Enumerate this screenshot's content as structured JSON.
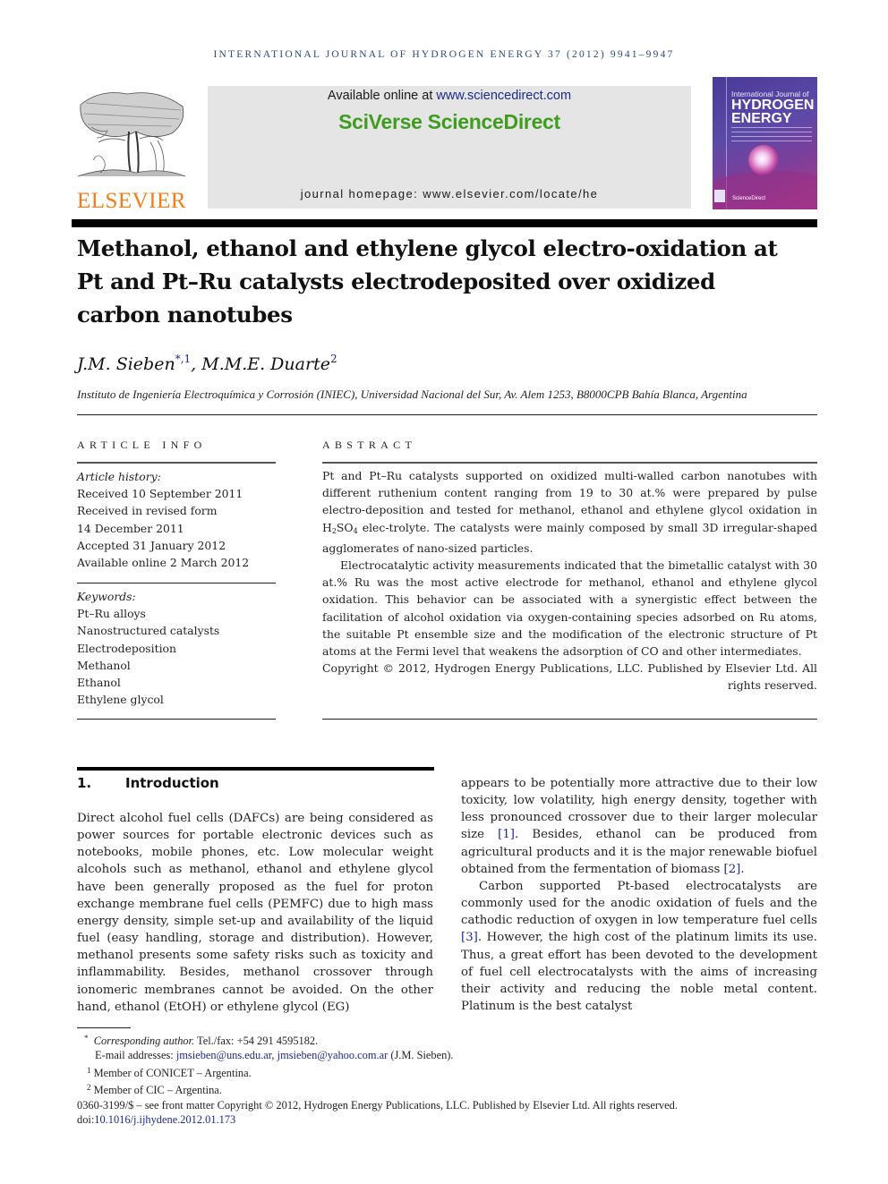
{
  "header": {
    "journal_citation": "INTERNATIONAL JOURNAL OF HYDROGEN ENERGY 37 (2012) 9941–9947",
    "publisher_wordmark": "ELSEVIER",
    "available_online_prefix": "Available online at ",
    "available_online_link": "www.sciencedirect.com",
    "platform_name": "SciVerse ScienceDirect",
    "journal_homepage": "journal homepage: www.elsevier.com/locate/he",
    "cover": {
      "line1": "International Journal of",
      "line2": "HYDROGEN",
      "line3": "ENERGY",
      "footer": "ScienceDirect"
    }
  },
  "article": {
    "title": "Methanol, ethanol and ethylene glycol electro-oxidation at Pt and Pt–Ru catalysts electrodeposited over oxidized carbon nanotubes",
    "authors": [
      {
        "name": "J.M. Sieben",
        "marks": "*,1"
      },
      {
        "name": "M.M.E. Duarte",
        "marks": "2"
      }
    ],
    "author_separator": ", ",
    "affiliation": "Instituto de Ingeniería Electroquímica y Corrosión (INIEC), Universidad Nacional del Sur, Av. Alem 1253, B8000CPB Bahía Blanca, Argentina"
  },
  "article_info": {
    "heading": "ARTICLE INFO",
    "history_label": "Article history:",
    "history": [
      "Received 10 September 2011",
      "Received in revised form",
      "14 December 2011",
      "Accepted 31 January 2012",
      "Available online 2 March 2012"
    ],
    "keywords_label": "Keywords:",
    "keywords": [
      "Pt–Ru alloys",
      "Nanostructured catalysts",
      "Electrodeposition",
      "Methanol",
      "Ethanol",
      "Ethylene glycol"
    ]
  },
  "abstract": {
    "heading": "ABSTRACT",
    "p1_before": "Pt and Pt–Ru catalysts supported on oxidized multi-walled carbon nanotubes with different ruthenium content ranging from 19 to 30 at.% were prepared by pulse electro-deposition and tested for methanol, ethanol and ethylene glycol oxidation in H",
    "p1_sub1": "2",
    "p1_mid": "SO",
    "p1_sub2": "4",
    "p1_after": " elec-trolyte. The catalysts were mainly composed by small 3D irregular-shaped agglomerates of nano-sized particles.",
    "p2": "Electrocatalytic activity measurements indicated that the bimetallic catalyst with 30 at.% Ru was the most active electrode for methanol, ethanol and ethylene glycol oxidation. This behavior can be associated with a synergistic effect between the facilitation of alcohol oxidation via oxygen-containing species adsorbed on Ru atoms, the suitable Pt ensemble size and the modification of the electronic structure of Pt atoms at the Fermi level that weakens the adsorption of CO and other intermediates.",
    "copyright": "Copyright © 2012, Hydrogen Energy Publications, LLC. Published by Elsevier Ltd. All rights reserved."
  },
  "introduction": {
    "number": "1.",
    "heading": "Introduction",
    "left_col_p1": "Direct alcohol fuel cells (DAFCs) are being considered as power sources for portable electronic devices such as notebooks, mobile phones, etc. Low molecular weight alcohols such as methanol, ethanol and ethylene glycol have been generally proposed as the fuel for proton exchange membrane fuel cells (PEMFC) due to high mass energy density, simple set-up and availability of the liquid fuel (easy handling, storage and distribution). However, methanol presents some safety risks such as toxicity and inflammability. Besides, methanol crossover through ionomeric membranes cannot be avoided. On the other hand, ethanol (EtOH) or ethylene glycol (EG)",
    "right_col_p1a": "appears to be potentially more attractive due to their low toxicity, low volatility, high energy density, together with less pronounced crossover due to their larger molecular size ",
    "ref1": "[1]",
    "right_col_p1b": ". Besides, ethanol can be produced from agricultural products and it is the major renewable biofuel obtained from the fermentation of biomass ",
    "ref2": "[2]",
    "right_col_p1c": ".",
    "right_col_p2a": "Carbon supported Pt-based electrocatalysts are commonly used for the anodic oxidation of fuels and the cathodic reduction of oxygen in low temperature fuel cells ",
    "ref3": "[3]",
    "right_col_p2b": ". However, the high cost of the platinum limits its use. Thus, a great effort has been devoted to the development of fuel cell electrocatalysts with the aims of increasing their activity and reducing the noble metal content. Platinum is the best catalyst"
  },
  "footnotes": {
    "corresponding_mark": "*",
    "corresponding_label": "Corresponding author.",
    "corresponding_contact": " Tel./fax: +54 291 4595182.",
    "email_label": "E-mail addresses: ",
    "email1": "jmsieben@uns.edu.ar",
    "email_sep": ", ",
    "email2": "jmsieben@yahoo.com.ar",
    "email_owner": " (J.M. Sieben).",
    "note1_mark": "1",
    "note1": " Member of CONICET – Argentina.",
    "note2_mark": "2",
    "note2": " Member of CIC – Argentina.",
    "front_matter": "0360-3199/$ – see front matter Copyright © 2012, Hydrogen Energy Publications, LLC. Published by Elsevier Ltd. All rights reserved.",
    "doi_label": "doi:",
    "doi": "10.1016/j.ijhydene.2012.01.173"
  },
  "colors": {
    "elsevier_orange": "#f07d1a",
    "sciverse_green": "#3f9c1f",
    "link_blue": "#1c2a8a",
    "journal_header_blue": "#2f4c7a"
  }
}
